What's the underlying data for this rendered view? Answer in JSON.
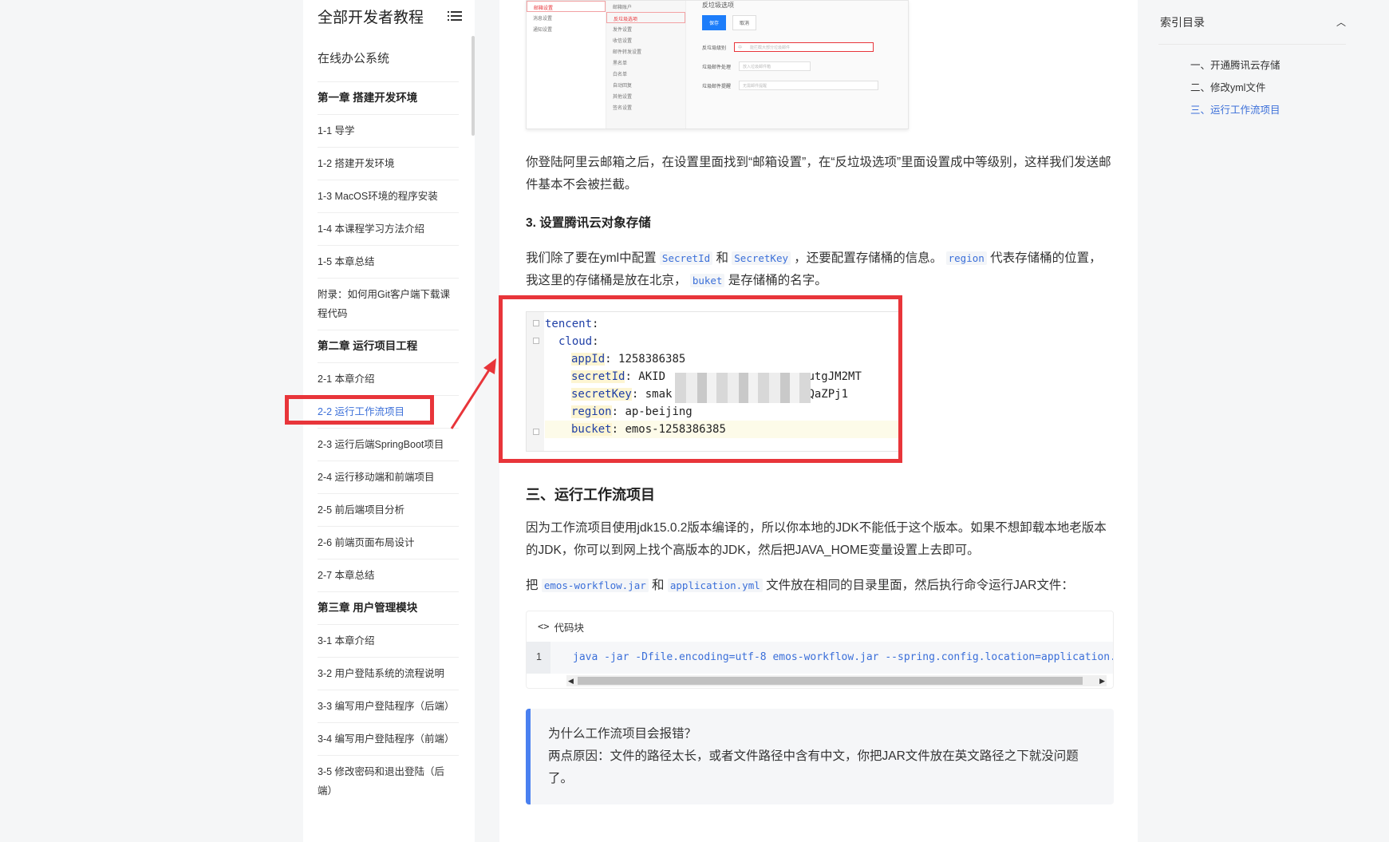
{
  "sidebar": {
    "title": "全部开发者教程",
    "course": "在线办公系统",
    "items": [
      {
        "label": "第一章 搭建开发环境",
        "type": "chapter"
      },
      {
        "label": "1-1 导学",
        "type": "lesson"
      },
      {
        "label": "1-2 搭建开发环境",
        "type": "lesson"
      },
      {
        "label": "1-3 MacOS环境的程序安装",
        "type": "lesson"
      },
      {
        "label": "1-4 本课程学习方法介绍",
        "type": "lesson"
      },
      {
        "label": "1-5 本章总结",
        "type": "lesson"
      },
      {
        "label": "附录：如何用Git客户端下载课程代码",
        "type": "lesson"
      },
      {
        "label": "第二章 运行项目工程",
        "type": "chapter"
      },
      {
        "label": "2-1 本章介绍",
        "type": "lesson"
      },
      {
        "label": "2-2 运行工作流项目",
        "type": "lesson",
        "active": true
      },
      {
        "label": "2-3 运行后端SpringBoot项目",
        "type": "lesson"
      },
      {
        "label": "2-4 运行移动端和前端项目",
        "type": "lesson"
      },
      {
        "label": "2-5 前后端项目分析",
        "type": "lesson"
      },
      {
        "label": "2-6 前端页面布局设计",
        "type": "lesson"
      },
      {
        "label": "2-7 本章总结",
        "type": "lesson"
      },
      {
        "label": "第三章 用户管理模块",
        "type": "chapter"
      },
      {
        "label": "3-1 本章介绍",
        "type": "lesson"
      },
      {
        "label": "3-2 用户登陆系统的流程说明",
        "type": "lesson"
      },
      {
        "label": "3-3 编写用户登陆程序（后端）",
        "type": "lesson"
      },
      {
        "label": "3-4 编写用户登陆程序（前端）",
        "type": "lesson"
      },
      {
        "label": "3-5 修改密码和退出登陆（后端）",
        "type": "lesson"
      }
    ]
  },
  "content": {
    "shot": {
      "panel_title": "反垃圾选项",
      "left_items": [
        "邮箱设置",
        "消息设置",
        "通知设置"
      ],
      "mid_items": [
        "邮箱账户",
        "反垃圾选项",
        "发件设置",
        "收信设置",
        "邮件转发设置",
        "黑名单",
        "白名单",
        "自动回复",
        "其他设置",
        "签名设置"
      ],
      "btn_save": "保存",
      "btn_cancel": "取消",
      "row1_label": "反垃圾级别",
      "row1_value": "中　　能拦截大部分垃圾邮件",
      "row2_label": "垃圾邮件处理",
      "row2_value": "放入垃圾邮件箱",
      "row3_label": "垃圾邮件提醒",
      "row3_value": "无需邮件提醒"
    },
    "para1": "你登陆阿里云邮箱之后，在设置里面找到“邮箱设置”，在“反垃圾选项”里面设置成中等级别，这样我们发送邮件基本不会被拦截。",
    "h3": "3. 设置腾讯云对象存储",
    "para2": {
      "t1": "我们除了要在yml中配置 ",
      "c1": "SecretId",
      "t2": " 和 ",
      "c2": "SecretKey",
      "t3": " ，还要配置存储桶的信息。 ",
      "c3": "region",
      "t4": " 代表存储桶的位置，我这里的存储桶是放在北京， ",
      "c4": "buket",
      "t5": " 是存储桶的名字。"
    },
    "yaml": {
      "l1k": "tencent",
      "l2k": "cloud",
      "l3k": "appId",
      "l3v": "1258386385",
      "l4k": "secretId",
      "l4v1": "AKID",
      "l4v2": "yutgJM2MT",
      "l5k": "secretKey",
      "l5v1": "smak",
      "l5v2": "QaZPj1",
      "l6k": "region",
      "l6v": "ap-beijing",
      "l7k": "bucket",
      "l7v": "emos-1258386385"
    },
    "h2": "三、运行工作流项目",
    "para3": "因为工作流项目使用jdk15.0.2版本编译的，所以你本地的JDK不能低于这个版本。如果不想卸载本地老版本的JDK，你可以到网上找个高版本的JDK，然后把JAVA_HOME变量设置上去即可。",
    "para4": {
      "t1": "把 ",
      "c1": "emos-workflow.jar",
      "t2": " 和 ",
      "c2": "application.yml",
      "t3": " 文件放在相同的目录里面，然后执行命令运行JAR文件："
    },
    "codeblock": {
      "header": "代码块",
      "line_no": "1",
      "code": "java -jar -Dfile.encoding=utf-8 emos-workflow.jar --spring.config.location=application.yml"
    },
    "tip": {
      "title": "为什么工作流项目会报错？",
      "body": "两点原因：文件的路径太长，或者文件路径中含有中文，你把JAR文件放在英文路径之下就没问题了。"
    }
  },
  "toc": {
    "title": "索引目录",
    "items": [
      "一、开通腾讯云存储",
      "二、修改yml文件",
      "三、运行工作流项目"
    ],
    "active_index": 2
  },
  "colors": {
    "accent": "#3b6fd9",
    "highlight_red": "#e8353a",
    "tip_border": "#4a80f0"
  }
}
